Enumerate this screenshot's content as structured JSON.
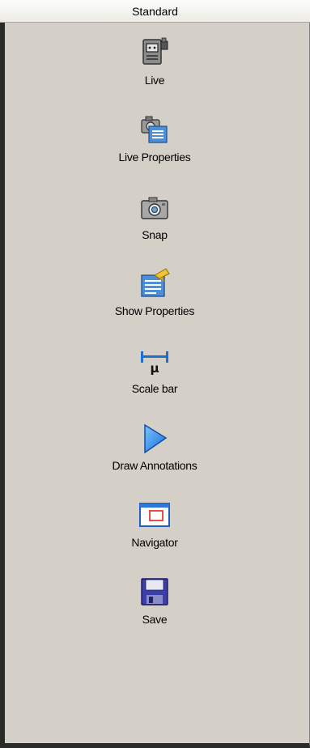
{
  "panel": {
    "title": "Standard"
  },
  "tools": [
    {
      "label": "Live",
      "icon": "video-camera-icon"
    },
    {
      "label": "Live Properties",
      "icon": "camera-properties-icon"
    },
    {
      "label": "Snap",
      "icon": "camera-icon"
    },
    {
      "label": "Show Properties",
      "icon": "show-properties-icon"
    },
    {
      "label": "Scale bar",
      "icon": "scale-bar-icon"
    },
    {
      "label": "Draw Annotations",
      "icon": "play-triangle-icon"
    },
    {
      "label": "Navigator",
      "icon": "navigator-window-icon"
    },
    {
      "label": "Save",
      "icon": "floppy-disk-icon"
    }
  ]
}
